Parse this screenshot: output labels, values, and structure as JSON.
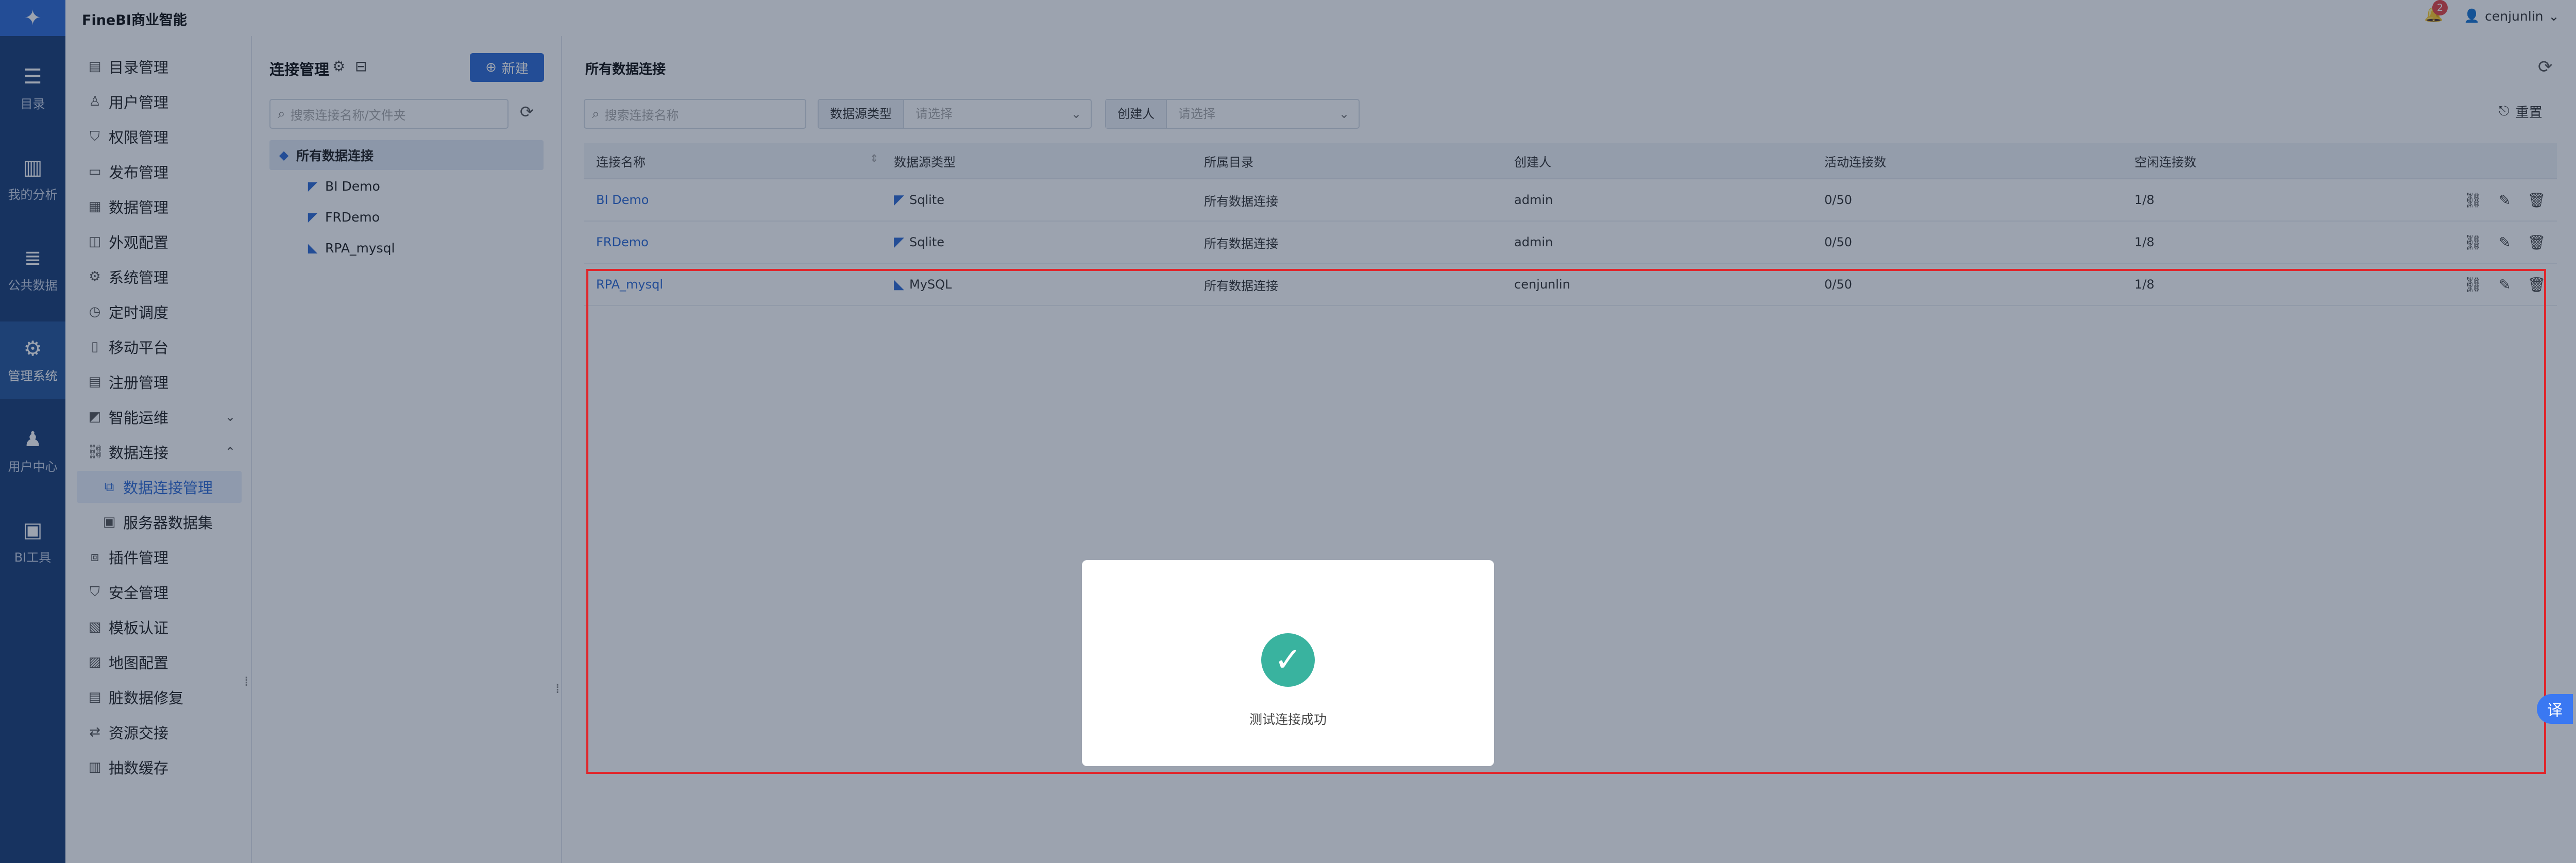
{
  "header": {
    "brand": "FineBI商业智能",
    "notification_count": "2",
    "username": "cenjunlin"
  },
  "rail": [
    {
      "label": "目录",
      "icon": "catalog-icon"
    },
    {
      "label": "我的分析",
      "icon": "chart-icon"
    },
    {
      "label": "公共数据",
      "icon": "database-icon"
    },
    {
      "label": "管理系统",
      "icon": "gear-icon"
    },
    {
      "label": "用户中心",
      "icon": "user-group-icon"
    },
    {
      "label": "BI工具",
      "icon": "toolbox-icon"
    }
  ],
  "menu": {
    "items": [
      {
        "label": "目录管理"
      },
      {
        "label": "用户管理"
      },
      {
        "label": "权限管理"
      },
      {
        "label": "发布管理"
      },
      {
        "label": "数据管理"
      },
      {
        "label": "外观配置"
      },
      {
        "label": "系统管理"
      },
      {
        "label": "定时调度"
      },
      {
        "label": "移动平台"
      },
      {
        "label": "注册管理"
      },
      {
        "label": "智能运维"
      },
      {
        "label": "数据连接"
      },
      {
        "label": "数据连接管理"
      },
      {
        "label": "服务器数据集"
      },
      {
        "label": "插件管理"
      },
      {
        "label": "安全管理"
      },
      {
        "label": "模板认证"
      },
      {
        "label": "地图配置"
      },
      {
        "label": "脏数据修复"
      },
      {
        "label": "资源交接"
      },
      {
        "label": "抽数缓存"
      }
    ]
  },
  "tree": {
    "title": "连接管理",
    "new_label": "新建",
    "search_placeholder": "搜索连接名称/文件夹",
    "root": "所有数据连接",
    "children": [
      "BI Demo",
      "FRDemo",
      "RPA_mysql"
    ]
  },
  "main": {
    "title": "所有数据连接",
    "search_placeholder": "搜索连接名称",
    "filter_type_label": "数据源类型",
    "filter_type_placeholder": "请选择",
    "filter_creator_label": "创建人",
    "filter_creator_placeholder": "请选择",
    "reset_label": "重置",
    "columns": [
      "连接名称",
      "数据源类型",
      "所属目录",
      "创建人",
      "活动连接数",
      "空闲连接数"
    ],
    "rows": [
      {
        "name": "BI Demo",
        "type": "Sqlite",
        "folder": "所有数据连接",
        "creator": "admin",
        "active": "0/50",
        "idle": "1/8"
      },
      {
        "name": "FRDemo",
        "type": "Sqlite",
        "folder": "所有数据连接",
        "creator": "admin",
        "active": "0/50",
        "idle": "1/8"
      },
      {
        "name": "RPA_mysql",
        "type": "MySQL",
        "folder": "所有数据连接",
        "creator": "cenjunlin",
        "active": "0/50",
        "idle": "1/8"
      }
    ]
  },
  "dialog": {
    "message": "测试连接成功"
  },
  "translate_label": "译",
  "colors": {
    "rail": "#1a3e78",
    "primary": "#2f6bd5",
    "success": "#39b39f",
    "highlight": "#e0262b"
  }
}
